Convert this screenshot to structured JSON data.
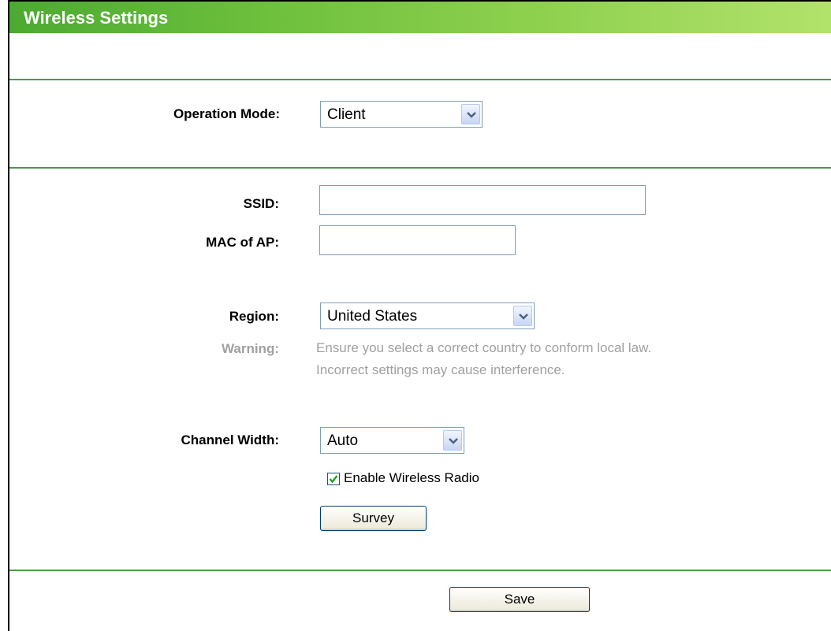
{
  "header": {
    "title": "Wireless Settings"
  },
  "operation_mode": {
    "label": "Operation Mode:",
    "value": "Client"
  },
  "ssid": {
    "label": "SSID:",
    "value": ""
  },
  "mac_of_ap": {
    "label": "MAC of AP:",
    "value": ""
  },
  "region": {
    "label": "Region:",
    "value": "United States",
    "warning_label": "Warning:",
    "warning_line1": "Ensure you select a correct country to conform local law.",
    "warning_line2": "Incorrect settings may cause interference."
  },
  "channel_width": {
    "label": "Channel Width:",
    "value": "Auto"
  },
  "enable_wireless_radio": {
    "label": "Enable Wireless Radio",
    "checked": true
  },
  "buttons": {
    "survey": "Survey",
    "save": "Save"
  },
  "colors": {
    "header_start": "#4caa32",
    "header_end": "#b2e26b",
    "divider": "#4a9a4a",
    "warning_text": "#a0a0a0"
  },
  "icons": {
    "dropdown": "chevron-down-icon",
    "checkbox": "checkmark-icon"
  }
}
